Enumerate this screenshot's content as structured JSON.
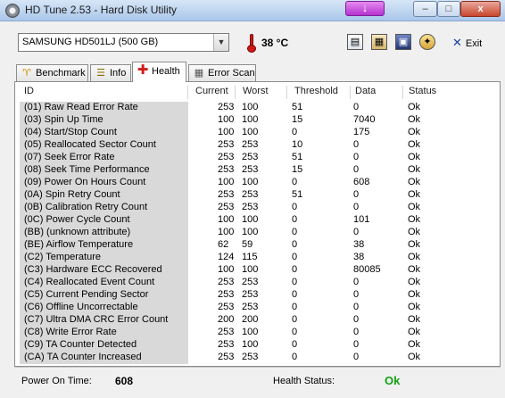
{
  "window": {
    "title": "HD Tune 2.53 - Hard Disk Utility",
    "minimize_glyph": "–",
    "maximize_glyph": "□",
    "close_glyph": "x",
    "center_button_glyph": "↓"
  },
  "toolbar": {
    "drive_value": "SAMSUNG HD501LJ (500 GB)",
    "temperature": "38 °C",
    "exit_label": "Exit",
    "icons": [
      "copy-text-icon",
      "copy-screenshot-icon",
      "save-icon",
      "options-icon"
    ]
  },
  "tabs": [
    {
      "label": "Benchmark",
      "icon": "benchmark-icon",
      "glyph": "♈"
    },
    {
      "label": "Info",
      "icon": "info-icon",
      "glyph": "☰"
    },
    {
      "label": "Health",
      "icon": "health-cross-icon",
      "glyph": "✚"
    },
    {
      "label": "Error Scan",
      "icon": "error-scan-icon",
      "glyph": "▦"
    }
  ],
  "table": {
    "columns": [
      "ID",
      "Current",
      "Worst",
      "Threshold",
      "Data",
      "Status"
    ],
    "rows": [
      [
        "(01) Raw Read Error Rate",
        "253",
        "100",
        "51",
        "0",
        "Ok"
      ],
      [
        "(03) Spin Up Time",
        "100",
        "100",
        "15",
        "7040",
        "Ok"
      ],
      [
        "(04) Start/Stop Count",
        "100",
        "100",
        "0",
        "175",
        "Ok"
      ],
      [
        "(05) Reallocated Sector Count",
        "253",
        "253",
        "10",
        "0",
        "Ok"
      ],
      [
        "(07) Seek Error Rate",
        "253",
        "253",
        "51",
        "0",
        "Ok"
      ],
      [
        "(08) Seek Time Performance",
        "253",
        "253",
        "15",
        "0",
        "Ok"
      ],
      [
        "(09) Power On Hours Count",
        "100",
        "100",
        "0",
        "608",
        "Ok"
      ],
      [
        "(0A) Spin Retry Count",
        "253",
        "253",
        "51",
        "0",
        "Ok"
      ],
      [
        "(0B) Calibration Retry Count",
        "253",
        "253",
        "0",
        "0",
        "Ok"
      ],
      [
        "(0C) Power Cycle Count",
        "100",
        "100",
        "0",
        "101",
        "Ok"
      ],
      [
        "(BB) (unknown attribute)",
        "100",
        "100",
        "0",
        "0",
        "Ok"
      ],
      [
        "(BE) Airflow Temperature",
        "62",
        "59",
        "0",
        "38",
        "Ok"
      ],
      [
        "(C2) Temperature",
        "124",
        "115",
        "0",
        "38",
        "Ok"
      ],
      [
        "(C3) Hardware ECC Recovered",
        "100",
        "100",
        "0",
        "80085",
        "Ok"
      ],
      [
        "(C4) Reallocated Event Count",
        "253",
        "253",
        "0",
        "0",
        "Ok"
      ],
      [
        "(C5) Current Pending Sector",
        "253",
        "253",
        "0",
        "0",
        "Ok"
      ],
      [
        "(C6) Offline Uncorrectable",
        "253",
        "253",
        "0",
        "0",
        "Ok"
      ],
      [
        "(C7) Ultra DMA CRC Error Count",
        "200",
        "200",
        "0",
        "0",
        "Ok"
      ],
      [
        "(C8) Write Error Rate",
        "253",
        "100",
        "0",
        "0",
        "Ok"
      ],
      [
        "(C9) TA Counter Detected",
        "253",
        "100",
        "0",
        "0",
        "Ok"
      ],
      [
        "(CA) TA Counter Increased",
        "253",
        "253",
        "0",
        "0",
        "Ok"
      ]
    ]
  },
  "status": {
    "power_on_time_label": "Power On Time:",
    "power_on_time_value": "608",
    "health_status_label": "Health Status:",
    "health_status_value": "Ok"
  },
  "colors": {
    "ok_green": "#12a012",
    "id_column_bg": "#d9d9d9",
    "thermometer_red": "#d01818"
  }
}
